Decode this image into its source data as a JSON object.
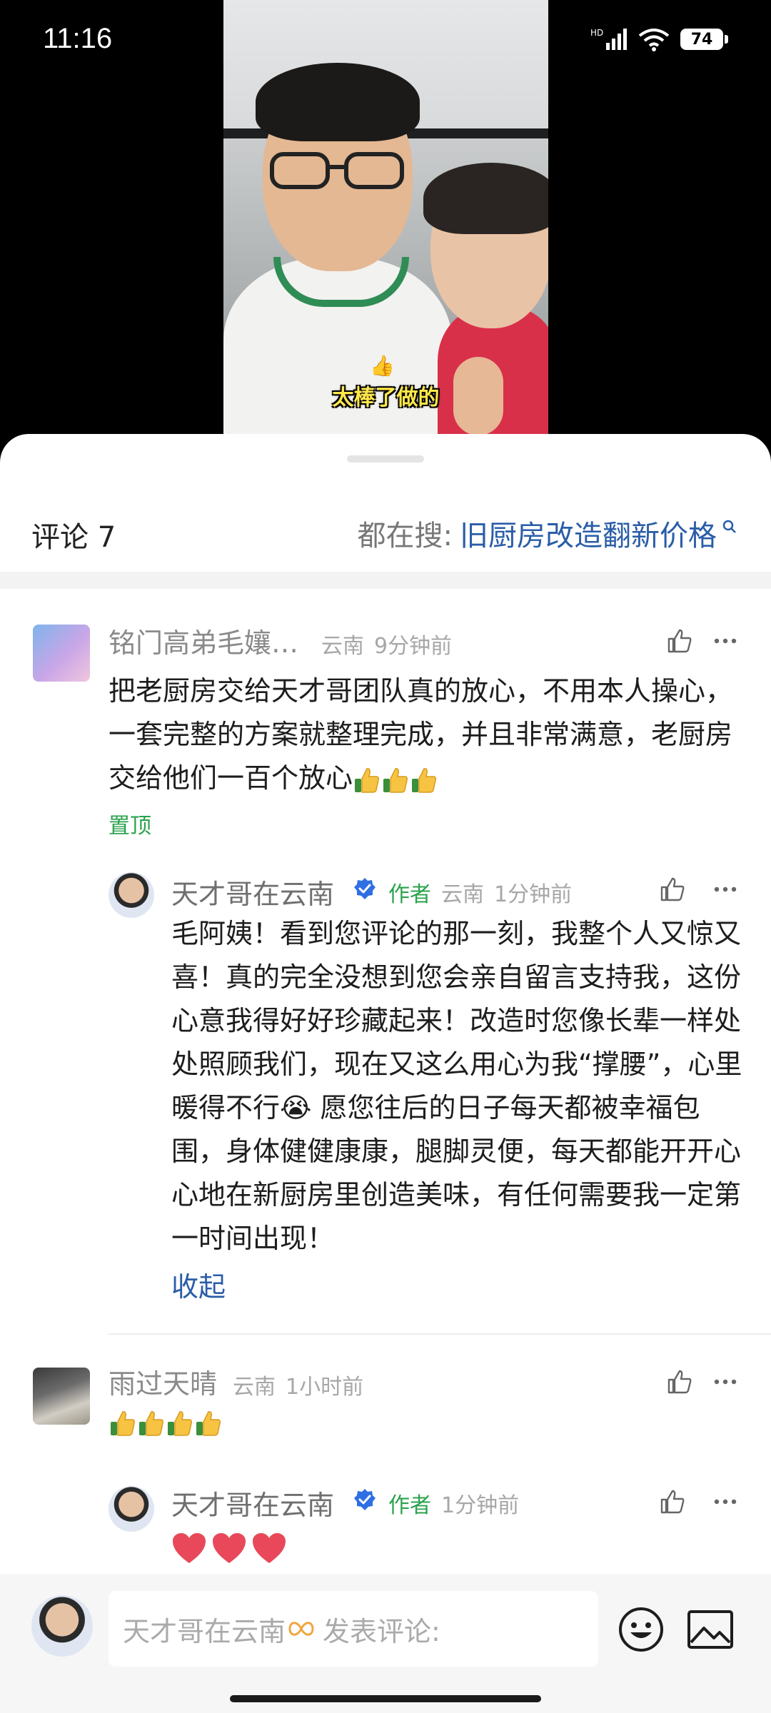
{
  "status_bar": {
    "time": "11:16",
    "battery": "74"
  },
  "video": {
    "caption": "太棒了做的"
  },
  "comments_header": {
    "title": "评论 7",
    "search_prefix": "都在搜:",
    "search_term": "旧厨房改造翻新价格"
  },
  "comments": [
    {
      "user": "铭门高弟毛孃…",
      "location": "云南",
      "time": "9分钟前",
      "text": "把老厨房交给天才哥团队真的放心，不用本人操心，一套完整的方案就整理完成，并且非常满意，老厨房交给他们一百个放心",
      "thumb_count": 3,
      "pinned_label": "置顶",
      "reply": {
        "user": "天才哥在云南",
        "author_tag": "作者",
        "location": "云南",
        "time": "1分钟前",
        "text": "毛阿姨！看到您评论的那一刻，我整个人又惊又喜！真的完全没想到您会亲自留言支持我，这份心意我得好好珍藏起来！改造时您像长辈一样处处照顾我们，现在又这么用心为我“撑腰”，心里暖得不行😭 愿您往后的日子每天都被幸福包围，身体健健康康，腿脚灵便，每天都能开开心心地在新厨房里创造美味，有任何需要我一定第一时间出现！",
        "collapse_label": "收起"
      }
    },
    {
      "user": "雨过天晴",
      "location": "云南",
      "time": "1小时前",
      "thumb_count": 4,
      "reply": {
        "user": "天才哥在云南",
        "author_tag": "作者",
        "time": "1分钟前",
        "heart_count": 3
      }
    }
  ],
  "input_bar": {
    "placeholder_user": "天才哥在云南",
    "placeholder_text": "发表评论:"
  },
  "colors": {
    "accent_green": "#2ba24c",
    "link_blue": "#2a5da8",
    "verified_blue": "#2f6fe4"
  }
}
